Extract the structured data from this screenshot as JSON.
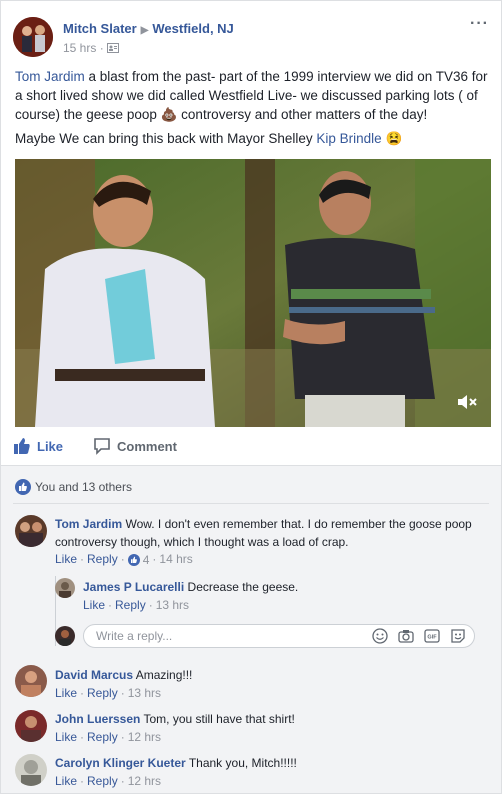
{
  "post": {
    "author": "Mitch Slater",
    "location": "Westfield, NJ",
    "time": "15 hrs",
    "text_line1_link": "Tom Jardim",
    "text_line1_rest": " a blast from the past- part of the 1999 interview we did on TV36 for a short lived show we did called Westfield Live- we discussed parking lots ( of course) the geese poop ",
    "text_line1_tail": " controversy and other matters of the day!",
    "text_line2_pre": "Maybe We can bring this back with Mayor Shelley ",
    "text_line2_link": "Kip Brindle",
    "poop_emoji": "💩",
    "tired_emoji": "😫"
  },
  "actions": {
    "like_label": "Like",
    "comment_label": "Comment"
  },
  "reactions": {
    "summary": "You and 13 others"
  },
  "comments": [
    {
      "name": "Tom Jardim",
      "text": "Wow. I don't even remember that. I do remember the goose poop controversy though, which I thought was a load of crap.",
      "like": "Like",
      "reply": "Reply",
      "reaction_count": "4",
      "time": "14 hrs"
    },
    {
      "name": "James P Lucarelli",
      "text": "Decrease the geese.",
      "like": "Like",
      "reply": "Reply",
      "time": "13 hrs"
    },
    {
      "name": "David Marcus",
      "text": "Amazing!!!",
      "like": "Like",
      "reply": "Reply",
      "time": "13 hrs"
    },
    {
      "name": "John Luerssen",
      "text": "Tom, you still have that shirt!",
      "like": "Like",
      "reply": "Reply",
      "time": "12 hrs"
    },
    {
      "name": "Carolyn Klinger Kueter",
      "text": "Thank you, Mitch!!!!!",
      "like": "Like",
      "reply": "Reply",
      "time": "12 hrs"
    }
  ],
  "reply_box": {
    "placeholder": "Write a reply..."
  },
  "colors": {
    "link": "#365899",
    "like_blue": "#4267b2",
    "meta_gray": "#90949c"
  },
  "icons": [
    "more-options-icon",
    "privacy-icon",
    "like-thumb-icon",
    "comment-bubble-icon",
    "like-reaction-icon",
    "mute-icon",
    "emoji-icon",
    "camera-icon",
    "gif-icon",
    "sticker-icon"
  ]
}
